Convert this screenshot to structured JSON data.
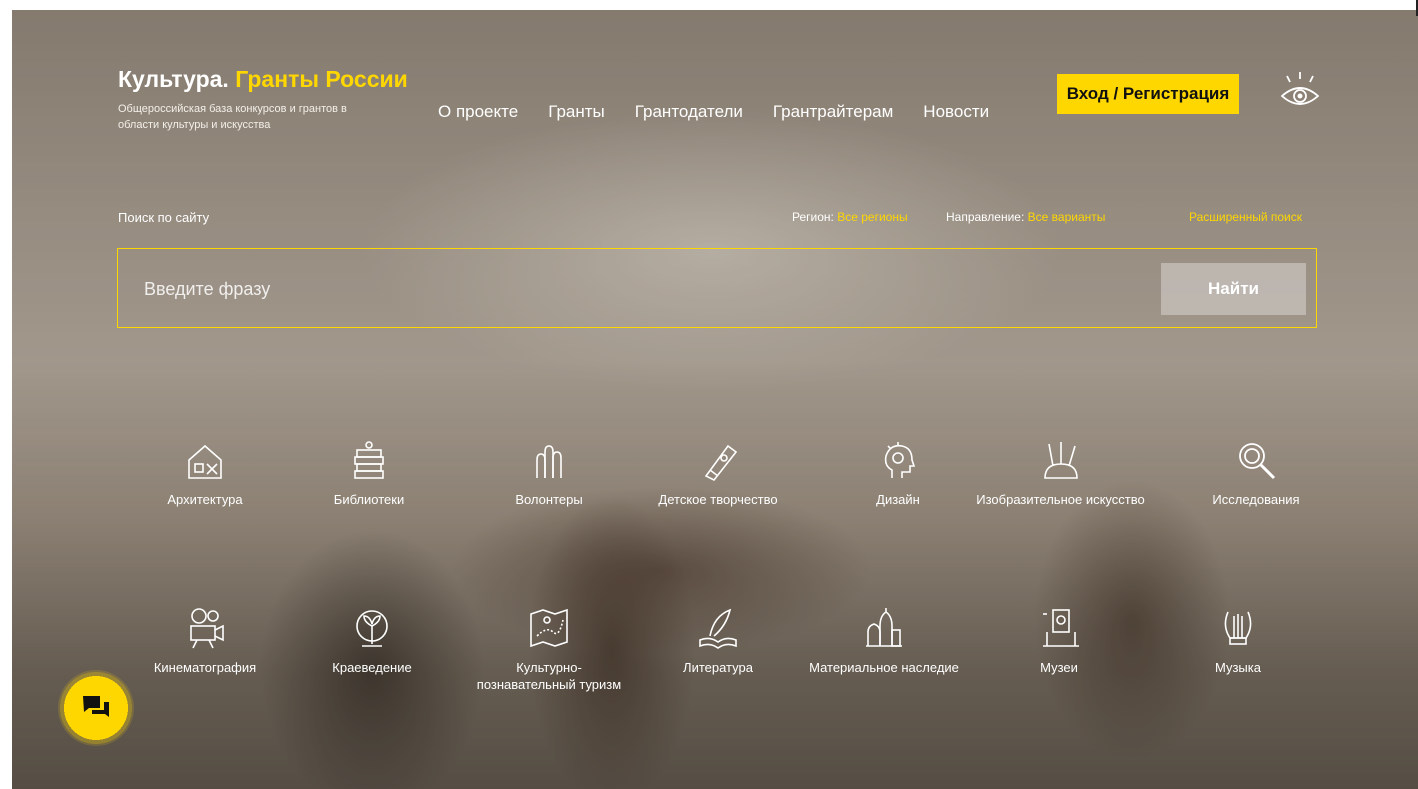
{
  "header": {
    "logo_title": "Культура.",
    "logo_accent": "Гранты России",
    "logo_subtitle": "Общероссийская база конкурсов и грантов в области культуры и искусства",
    "nav": [
      "О проекте",
      "Гранты",
      "Грантодатели",
      "Грантрайтерам",
      "Новости"
    ],
    "login_label": "Вход / Регистрация",
    "accessibility_icon": "eye-icon"
  },
  "search": {
    "label": "Поиск по сайту",
    "region_label": "Регион:",
    "region_value": "Все регионы",
    "direction_label": "Направление:",
    "direction_value": "Все варианты",
    "advanced_label": "Расширенный поиск",
    "placeholder": "Введите фразу",
    "button_label": "Найти"
  },
  "categories": [
    {
      "label": "Архитектура",
      "icon": "architecture-icon"
    },
    {
      "label": "Библиотеки",
      "icon": "books-icon"
    },
    {
      "label": "Волонтеры",
      "icon": "hands-icon"
    },
    {
      "label": "Детское творчество",
      "icon": "crayon-icon"
    },
    {
      "label": "Дизайн",
      "icon": "head-bulb-icon"
    },
    {
      "label": "Изобразительное искусство",
      "icon": "brushes-icon"
    },
    {
      "label": "Исследования",
      "icon": "magnifier-icon"
    },
    {
      "label": "Кинематография",
      "icon": "film-camera-icon"
    },
    {
      "label": "Краеведение",
      "icon": "globe-plant-icon"
    },
    {
      "label": "Культурно-познавательный туризм",
      "icon": "map-icon"
    },
    {
      "label": "Литература",
      "icon": "quill-book-icon"
    },
    {
      "label": "Материальное наследие",
      "icon": "cathedral-icon"
    },
    {
      "label": "Музеи",
      "icon": "museum-exhibit-icon"
    },
    {
      "label": "Музыка",
      "icon": "lyre-icon"
    }
  ],
  "chat_icon": "chat-bubbles-icon",
  "colors": {
    "accent": "#ffd700",
    "text": "#ffffff"
  }
}
